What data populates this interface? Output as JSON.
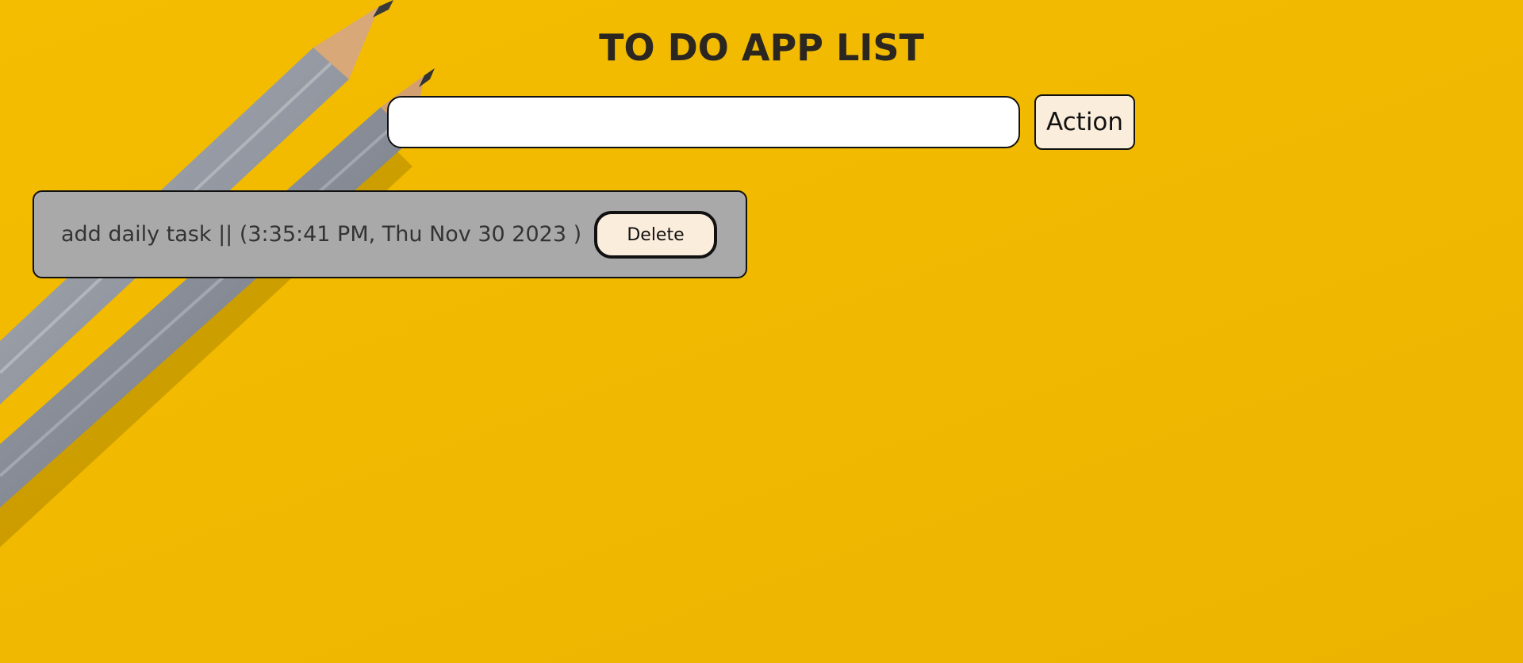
{
  "app": {
    "title": "TO DO APP LIST"
  },
  "input": {
    "value": "",
    "placeholder": ""
  },
  "action_button": {
    "label": "Action"
  },
  "tasks": [
    {
      "text": "add daily task || (3:35:41 PM, Thu Nov 30 2023 )",
      "delete_label": "Delete"
    }
  ],
  "colors": {
    "background": "#f1b900",
    "task_card": "#a9a9a9",
    "button_fill": "#fbeddb",
    "title_text": "#2b2620"
  },
  "background_decor": "pencils-image"
}
